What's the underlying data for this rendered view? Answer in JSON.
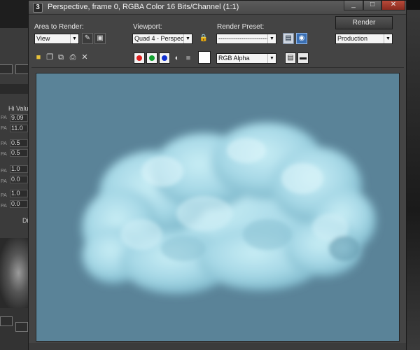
{
  "window": {
    "title": "Perspective, frame 0, RGBA Color 16 Bits/Channel (1:1)",
    "logo": "3",
    "controls": {
      "minimize": "_",
      "maximize": "□",
      "close": "✕"
    }
  },
  "toolbar": {
    "area_to_render_label": "Area to Render:",
    "area_to_render_value": "View",
    "viewport_label": "Viewport:",
    "viewport_value": "Quad 4 - Perspec",
    "render_preset_label": "Render Preset:",
    "render_preset_value": "----------------------------",
    "render_button": "Render",
    "render_mode_value": "Production",
    "channel_value": "RGB Alpha",
    "icons": {
      "edit_region": "edit-region-icon",
      "auto_region": "auto-region-icon",
      "lock": "lock-icon",
      "environment": "environment-icon",
      "render_setup": "render-setup-icon",
      "save": "save-icon",
      "copy": "copy-icon",
      "clone": "clone-icon",
      "print": "print-icon",
      "clear": "clear-icon",
      "mono": "mono-icon",
      "display_alpha": "display-alpha-icon",
      "toggle_ui": "toggle-ui-icon",
      "toggle_overlay": "toggle-overlay-icon"
    },
    "channel_colors": {
      "red": "#e02020",
      "green": "#12a030",
      "blue": "#1030d0"
    },
    "swatch_color": "#ffffff"
  },
  "viewport": {
    "background_color": "#5a8398",
    "cloud_color": "#a9dbe8"
  },
  "background_app": {
    "hi_value_label": "Hi Valu",
    "fields": [
      "9.09",
      "11.0",
      "0.5",
      "0.5",
      "1.0",
      "0.0",
      "1.0",
      "0.0"
    ],
    "pa_labels": [
      "PA",
      "PA",
      "PA",
      "PA",
      "PA",
      "PA",
      "PA",
      "PA"
    ],
    "misc_label": "Di"
  }
}
